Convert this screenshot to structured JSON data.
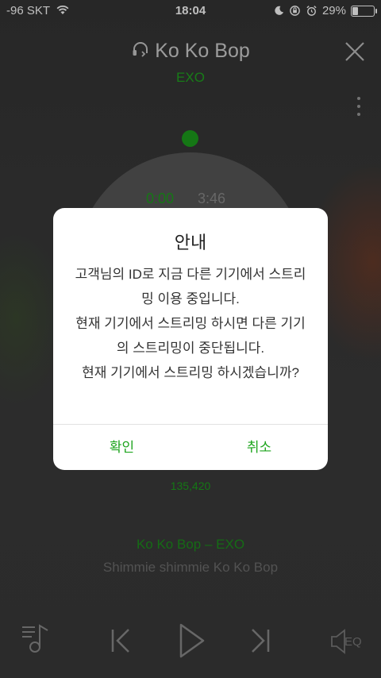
{
  "status_bar": {
    "carrier": "-96 SKT",
    "time": "18:04",
    "battery_percent": "29%",
    "battery_level": 0.29
  },
  "player": {
    "song_title": "Ko Ko Bop",
    "artist": "EXO",
    "current_time": "0:00",
    "total_time": "3:46",
    "likes": "135,420",
    "lyric_title": "Ko Ko Bop – EXO",
    "lyric_line": "Shimmie shimmie Ko Ko Bop"
  },
  "controls": {
    "eq_label": "EQ"
  },
  "dialog": {
    "title": "안내",
    "message": "고객님의 ID로 지금 다른 기기에서 스트리밍 이용 중입니다.\n현재 기기에서 스트리밍 하시면 다른 기기의 스트리밍이 중단됩니다.\n현재 기기에서 스트리밍 하시겠습니까?",
    "confirm_label": "확인",
    "cancel_label": "취소"
  },
  "colors": {
    "accent": "#1fa51f",
    "background": "#3a3a3a"
  }
}
